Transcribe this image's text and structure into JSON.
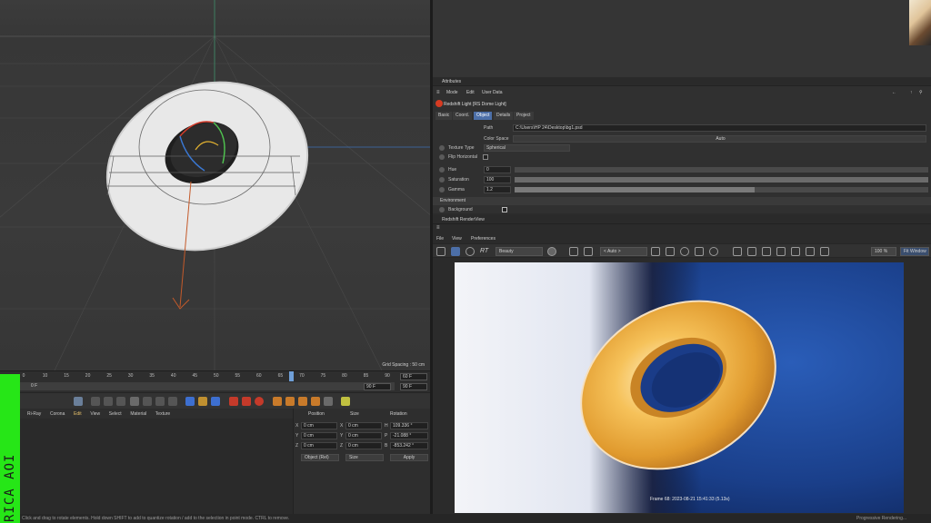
{
  "viewport": {
    "grid_spacing": "Grid Spacing : 50 cm"
  },
  "timeline": {
    "ticks": [
      "0",
      "10",
      "15",
      "20",
      "25",
      "30",
      "35",
      "40",
      "45",
      "50",
      "55",
      "60",
      "65",
      "70",
      "75",
      "80",
      "85",
      "90"
    ],
    "current": "0 F",
    "frame_end_a": "60 F",
    "frame_end_b": "90 F",
    "frame_end_c": "90 F",
    "frame_end_d": "90 F"
  },
  "materials": {
    "menu": [
      "Ri-Ray",
      "Corona",
      "Edit",
      "View",
      "Select",
      "Material",
      "Texture"
    ]
  },
  "coordinates": {
    "headers": [
      "Position",
      "Size",
      "Rotation"
    ],
    "rows": [
      {
        "axis": "X",
        "pos": "0 cm",
        "size_axis": "X",
        "size": "0 cm",
        "rot_axis": "H",
        "rot": "109.336 °"
      },
      {
        "axis": "Y",
        "pos": "0 cm",
        "size_axis": "Y",
        "size": "0 cm",
        "rot_axis": "P",
        "rot": "-21.088 °"
      },
      {
        "axis": "Z",
        "pos": "0 cm",
        "size_axis": "Z",
        "size": "0 cm",
        "rot_axis": "B",
        "rot": "-853.242 °"
      }
    ],
    "mode": "Object (Rel)",
    "size_mode": "Size",
    "apply": "Apply"
  },
  "side_label": "RICA AOI",
  "status": {
    "hint": "Click and drag to rotate elements. Hold down SHIFT to add to quantize rotation / add to the selection in point mode. CTRL to remove.",
    "right": "Progressive Rendering..."
  },
  "attributes": {
    "title": "Attributes",
    "menu": [
      "Mode",
      "Edit",
      "User Data"
    ],
    "object": "Redshift Light [RS Dome Light]",
    "tabs": [
      "Basic",
      "Coord.",
      "Object",
      "Details",
      "Project"
    ],
    "active_tab": "Object",
    "path_label": "Path",
    "path_value": "C:\\Users\\HP 24\\Desktop\\bg1.psd",
    "color_space_label": "Color Space",
    "color_space_value": "Auto",
    "texture_type_label": "Texture Type",
    "texture_type_value": "Spherical",
    "flip_label": "Flip Horizontal",
    "hue_label": "Hue",
    "hue_value": "0",
    "saturation_label": "Saturation",
    "saturation_value": "100",
    "gamma_label": "Gamma",
    "gamma_value": "1.2",
    "gamma_fill": 0.58,
    "section": "Environment",
    "background_label": "Background"
  },
  "renderview": {
    "title": "Redshift RenderView",
    "menu": [
      "File",
      "View",
      "Preferences"
    ],
    "aov": "Beauty",
    "auto": "< Auto >",
    "zoom": "100 %",
    "fit": "Fit Window",
    "frame_info": "Frame  68:  2023-08-21  15:41:33  (5.13s)"
  },
  "colors": {
    "accent": "#4c6fa8",
    "green": "#26e617",
    "torus_orange": "#f2b24a"
  }
}
